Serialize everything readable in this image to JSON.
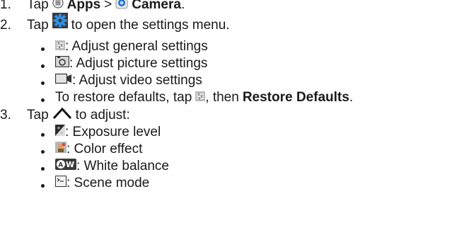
{
  "steps": [
    {
      "number": "1.",
      "text_tap": "Tap",
      "apps_label": "Apps",
      "separator": ">",
      "camera_label": "Camera",
      "end": "."
    },
    {
      "number": "2.",
      "text_tap": "Tap",
      "text_after": "to open the settings menu.",
      "bullets": [
        {
          "icon": "general-settings-icon",
          "text": ": Adjust general settings"
        },
        {
          "icon": "picture-settings-icon",
          "text": ": Adjust picture settings"
        },
        {
          "icon": "video-settings-icon",
          "text": ": Adjust video settings"
        }
      ],
      "restore": {
        "before": "To restore defaults, tap",
        "middle": ", then",
        "bold": "Restore Defaults",
        "end": "."
      }
    },
    {
      "number": "3.",
      "text_tap": "Tap",
      "text_after": "to adjust:",
      "bullets": [
        {
          "icon": "exposure-icon",
          "text": ": Exposure level"
        },
        {
          "icon": "color-effect-icon",
          "text": ": Color effect"
        },
        {
          "icon": "white-balance-icon",
          "text": ": White balance"
        },
        {
          "icon": "scene-mode-icon",
          "text": ": Scene mode"
        }
      ]
    }
  ],
  "colors": {
    "text": "#1a1a1a",
    "settings_gear": "#1f7fd6",
    "camera_icon": "#1f6fd0"
  }
}
